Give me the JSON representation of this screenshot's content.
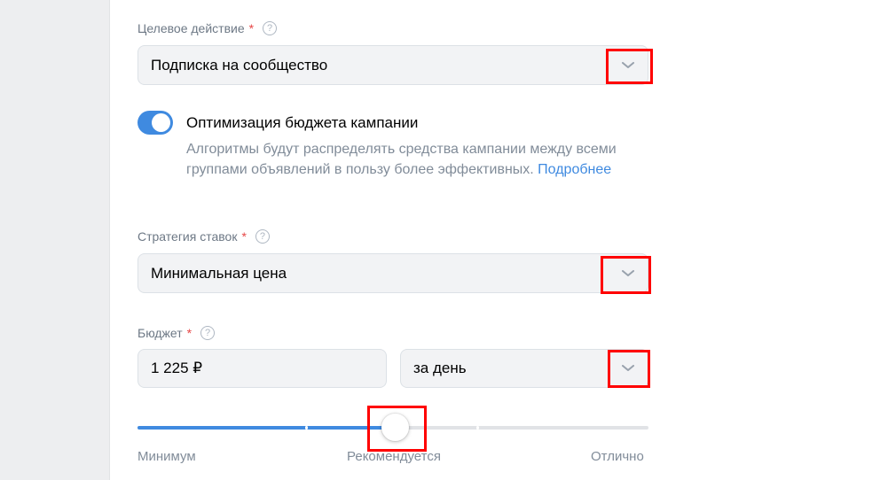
{
  "target_action": {
    "label": "Целевое действие",
    "required_mark": "*",
    "help": "?",
    "value": "Подписка на сообщество"
  },
  "budget_optimization": {
    "enabled": true,
    "title": "Оптимизация бюджета кампании",
    "description": "Алгоритмы будут распределять средства кампании между всеми группами объявлений в пользу более эффективных.",
    "link": "Подробнее"
  },
  "bid_strategy": {
    "label": "Стратегия ставок",
    "required_mark": "*",
    "help": "?",
    "value": "Минимальная цена"
  },
  "budget": {
    "label": "Бюджет",
    "required_mark": "*",
    "help": "?",
    "amount": "1 225 ₽",
    "period": "за день"
  },
  "budget_slider": {
    "level": 0.5,
    "labels": [
      "Минимум",
      "Рекомендуется",
      "Отлично"
    ]
  },
  "colors": {
    "accent": "#3f8ae0",
    "highlight": "#ff0000",
    "required": "#e64646"
  }
}
